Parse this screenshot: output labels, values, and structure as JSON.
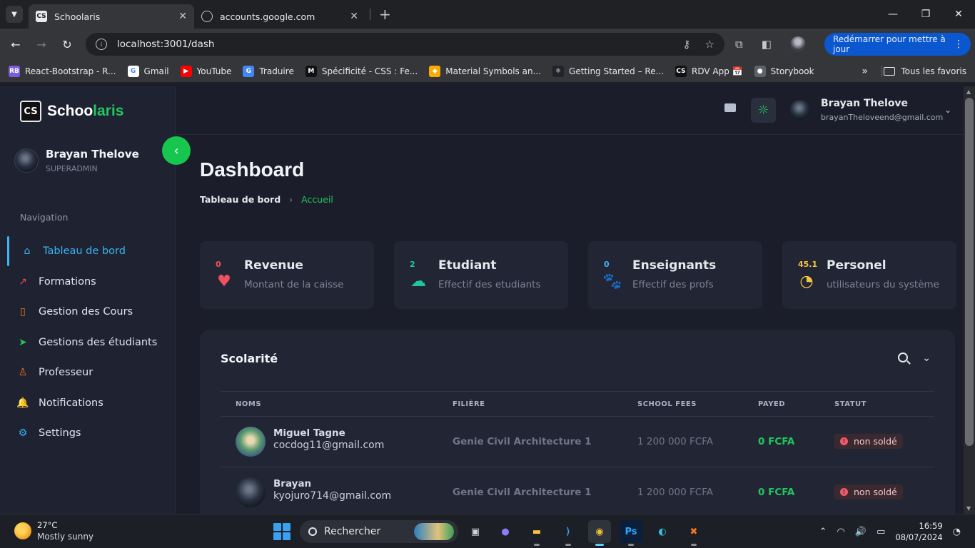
{
  "browser": {
    "tabs": [
      {
        "title": "Schoolaris",
        "favicon": "CS",
        "active": true
      },
      {
        "title": "accounts.google.com",
        "favicon": "globe",
        "active": false
      }
    ],
    "url": "localhost:3001/dash",
    "update_button": "Redémarrer pour mettre à jour",
    "bookmarks": [
      {
        "label": "React-Bootstrap - R...",
        "icon": "react-bootstrap-icon",
        "color": "#7b5ce0",
        "glyph": "RB"
      },
      {
        "label": "Gmail",
        "icon": "google-icon",
        "color": "#ffffff",
        "glyph": "G"
      },
      {
        "label": "YouTube",
        "icon": "youtube-icon",
        "color": "#ff0000",
        "glyph": "▶"
      },
      {
        "label": "Traduire",
        "icon": "translate-icon",
        "color": "#4285f4",
        "glyph": "G"
      },
      {
        "label": "Spécificité - CSS : Fe...",
        "icon": "mdn-icon",
        "color": "#111111",
        "glyph": "M"
      },
      {
        "label": "Material Symbols an...",
        "icon": "material-icon",
        "color": "#f9ab00",
        "glyph": "◆"
      },
      {
        "label": "Getting Started – Re...",
        "icon": "react-icon",
        "color": "#20232a",
        "glyph": "⚛"
      },
      {
        "label": "RDV App 📅",
        "icon": "cs-icon",
        "color": "#111111",
        "glyph": "CS"
      },
      {
        "label": "Storybook",
        "icon": "storybook-icon",
        "color": "#5f6368",
        "glyph": "●"
      }
    ],
    "all_bookmarks": "Tous les favoris"
  },
  "app": {
    "brand_prefix": "Schoo",
    "brand_suffix": "laris",
    "logo_text": "CS",
    "user": {
      "name": "Brayan Thelove",
      "role": "SUPERADMIN",
      "email": "brayanTheloveend@gmail.com"
    },
    "nav_title": "Navigation",
    "nav_items": [
      {
        "label": "Tableau de bord",
        "icon": "dashboard-icon",
        "glyph": "⌂",
        "color": "#3ab4f2",
        "active": true
      },
      {
        "label": "Formations",
        "icon": "trending-icon",
        "glyph": "↗",
        "color": "#ef4444"
      },
      {
        "label": "Gestion des Cours",
        "icon": "book-icon",
        "glyph": "▯",
        "color": "#f97316"
      },
      {
        "label": "Gestions des étudiants",
        "icon": "send-icon",
        "glyph": "➤",
        "color": "#22c55e"
      },
      {
        "label": "Professeur",
        "icon": "user-icon",
        "glyph": "♙",
        "color": "#f97316"
      },
      {
        "label": "Notifications",
        "icon": "bell-icon",
        "glyph": "🔔",
        "color": "#ec4899"
      },
      {
        "label": "Settings",
        "icon": "gear-icon",
        "glyph": "⚙",
        "color": "#3ab4f2"
      }
    ],
    "page_title": "Dashboard",
    "breadcrumb": {
      "root": "Tableau de bord",
      "separator": "›",
      "current": "Accueil"
    },
    "stats": [
      {
        "value": "0",
        "label": "Revenue",
        "sub": "Montant de la caisse",
        "icon": "heartbeat-icon",
        "glyph": "♥",
        "color": "#f0505f"
      },
      {
        "value": "2",
        "label": "Etudiant",
        "sub": "Effectif des etudiants",
        "icon": "rain-cloud-icon",
        "glyph": "☁",
        "color": "#22c5a0"
      },
      {
        "value": "0",
        "label": "Enseignants",
        "sub": "Effectif des profs",
        "icon": "paw-icon",
        "glyph": "🐾",
        "color": "#3ab4f2"
      },
      {
        "value": "45.1",
        "label": "Personel",
        "sub": "utilisateurs du système",
        "icon": "gauge-icon",
        "glyph": "◔",
        "color": "#f5c542"
      }
    ],
    "table": {
      "title": "Scolarité",
      "columns": [
        "NOMS",
        "FILIÈRE",
        "SCHOOL FEES",
        "PAYED",
        "STATUT"
      ],
      "rows": [
        {
          "name": "Miguel Tagne",
          "email": "cocdog11@gmail.com",
          "filiere": "Genie Civil Architecture 1",
          "fees": "1 200 000 FCFA",
          "payed": "0 FCFA",
          "status": "non soldé"
        },
        {
          "name": "Brayan",
          "email": "kyojuro714@gmail.com",
          "filiere": "Genie Civil Architecture 1",
          "fees": "1 200 000 FCFA",
          "payed": "0 FCFA",
          "status": "non soldé"
        }
      ]
    }
  },
  "taskbar": {
    "temperature": "27°C",
    "weather": "Mostly sunny",
    "search_placeholder": "Rechercher",
    "time": "16:59",
    "date": "08/07/2024"
  }
}
